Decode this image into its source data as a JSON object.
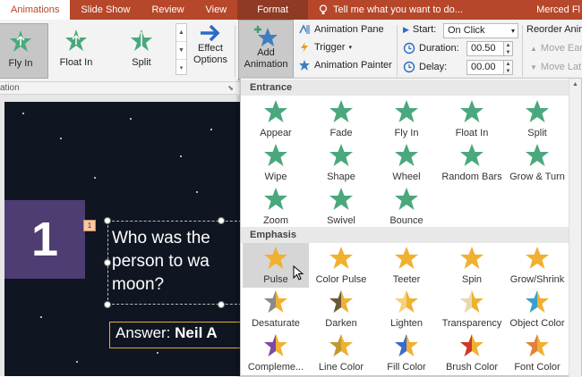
{
  "tabs": [
    {
      "label": "Animations",
      "active": true
    },
    {
      "label": "Slide Show"
    },
    {
      "label": "Review"
    },
    {
      "label": "View"
    },
    {
      "label": "Format",
      "contextual": true
    }
  ],
  "tell_me": "Tell me what you want to do...",
  "user_name": "Merced Fl",
  "ribbon": {
    "gallery": [
      {
        "label": "Fly In",
        "selected": true
      },
      {
        "label": "Float In"
      },
      {
        "label": "Split"
      }
    ],
    "effect_options": [
      "Effect",
      "Options"
    ],
    "add_animation": [
      "Add",
      "Animation"
    ],
    "animation_pane": "Animation Pane",
    "trigger": "Trigger",
    "animation_painter": "Animation Painter",
    "start_label": "Start:",
    "start_value": "On Click",
    "duration_label": "Duration:",
    "duration_value": "00.50",
    "delay_label": "Delay:",
    "delay_value": "00.00",
    "reorder_label": "Reorder Anim",
    "move_earlier": "Move Earl",
    "move_later": "Move Lat",
    "group_label": "ation"
  },
  "slide": {
    "number": "1",
    "anim_tag": "1",
    "question_lines": [
      "Who was the",
      "person to wa",
      "moon?"
    ],
    "answer_prefix": "Answer:",
    "answer_name": "Neil A"
  },
  "gallery_sections": {
    "entrance": "Entrance",
    "emphasis": "Emphasis",
    "entrance_items": [
      "Appear",
      "Fade",
      "Fly In",
      "Float In",
      "Split",
      "Wipe",
      "Shape",
      "Wheel",
      "Random Bars",
      "Grow & Turn",
      "Zoom",
      "Swivel",
      "Bounce"
    ],
    "emphasis_items": [
      "Pulse",
      "Color Pulse",
      "Teeter",
      "Spin",
      "Grow/Shrink",
      "Desaturate",
      "Darken",
      "Lighten",
      "Transparency",
      "Object Color",
      "Compleme...",
      "Line Color",
      "Fill Color",
      "Brush Color",
      "Font Color"
    ],
    "hovered": "Pulse"
  },
  "colors": {
    "accent": "#b7472a",
    "entrance_star": "#4aa87c",
    "emphasis_star": "#f0b030",
    "slide_bg": "#101522",
    "number_box": "#4d3d72"
  }
}
